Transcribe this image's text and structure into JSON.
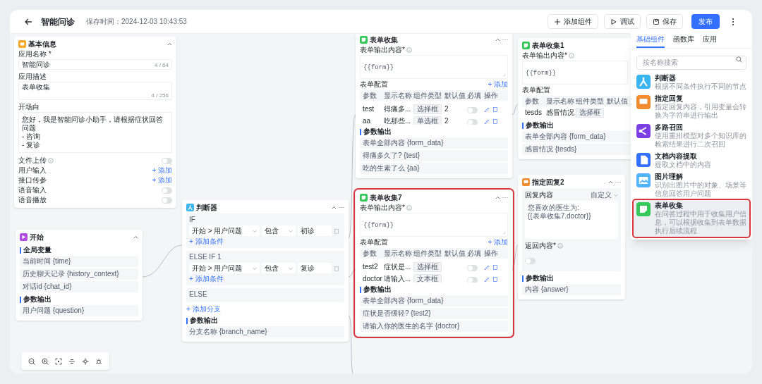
{
  "header": {
    "title": "智能问诊",
    "save_time": "保存时间：2024-12-03 10:43:53",
    "actions": [
      {
        "kind": "add",
        "label": "添加组件"
      },
      {
        "kind": "debug",
        "label": "调试"
      },
      {
        "kind": "save",
        "label": "保存"
      },
      {
        "kind": "publish",
        "label": "发布"
      }
    ]
  },
  "nodes": [
    {
      "kind": "base_info",
      "title": "基本信息",
      "selected": false,
      "fields": [
        {
          "label": "应用名称 *",
          "value": "智能问诊",
          "counter": "4 / 64"
        },
        {
          "label": "应用描述",
          "value": "表单收集",
          "counter": "4 / 256"
        },
        {
          "label": "开场白",
          "lines": [
            "您好，我是智能问诊小助手，请根据症状回答问题",
            "- 咨询",
            "- 复诊"
          ]
        }
      ],
      "settings": [
        {
          "kind": "toggle",
          "label": "文件上传",
          "info": true,
          "on": false
        },
        {
          "kind": "add",
          "label": "用户输入",
          "info": false,
          "action": "+ 添加"
        },
        {
          "kind": "add",
          "label": "接口传参",
          "info": false,
          "action": "+ 添加"
        },
        {
          "kind": "toggle",
          "label": "语音输入",
          "info": false,
          "on": false
        },
        {
          "kind": "toggle",
          "label": "语音播放",
          "info": false,
          "on": false
        }
      ]
    },
    {
      "kind": "form",
      "title": "表单收集",
      "selected": false,
      "output_label": "表单输出内容*",
      "template": "{{form}}",
      "config_label": "表单配置",
      "add": "+ 添加",
      "columns": [
        "参数",
        "显示名称",
        "组件类型",
        "默认值",
        "必填",
        "操作"
      ],
      "rows": [
        {
          "cells": [
            "test",
            "得痛多...",
            "选择框",
            "2"
          ],
          "required": false
        },
        {
          "cells": [
            "aa",
            "吃那些...",
            "单选框",
            "2"
          ],
          "required": false
        }
      ],
      "outputs_label": "参数输出",
      "outputs": [
        "表单全部内容 {form_data}",
        "得痛多久了? {test}",
        "吃的生素了么 {aa}"
      ]
    },
    {
      "kind": "form",
      "title": "表单收集1",
      "selected": false,
      "output_label": "表单输出内容*",
      "template": "{{form}}",
      "config_label": "表单配置",
      "columns": [
        "参数",
        "显示名称",
        "组件类型",
        "默认值"
      ],
      "rows": [
        {
          "cells": [
            "tesds",
            "感冒情况",
            "选择框",
            ""
          ]
        }
      ],
      "outputs_label": "参数输出",
      "outputs": [
        "表单全部内容 {form_data}",
        "感冒情况 {tesds}"
      ]
    },
    {
      "kind": "start",
      "title": "开始",
      "selected": false,
      "groups": [
        {
          "label": "全局变量",
          "items": [
            "当前时间 {time}",
            "历史聊天记录 {history_context}",
            "对话id {chat_id}"
          ]
        },
        {
          "label": "参数输出",
          "items": [
            "用户问题 {question}"
          ]
        }
      ]
    },
    {
      "kind": "condition",
      "title": "判断器",
      "selected": false,
      "branches": [
        {
          "label": "IF",
          "conditions": [
            {
              "field": "开始 > 用户问题",
              "op": "包含",
              "value": "初诊"
            }
          ],
          "add": "+ 添加条件"
        },
        {
          "label": "ELSE IF 1",
          "conditions": [
            {
              "field": "开始 > 用户问题",
              "op": "包含",
              "value": "复诊"
            }
          ],
          "add": "+ 添加条件"
        },
        {
          "label": "ELSE"
        }
      ],
      "add_branch": "+ 添加分支",
      "outputs_label": "参数输出",
      "outputs": [
        "分支名称 {branch_name}"
      ]
    },
    {
      "kind": "form",
      "title": "表单收集7",
      "selected": true,
      "output_label": "表单输出内容*",
      "template": "{{form}}",
      "config_label": "表单配置",
      "add": "+ 添加",
      "columns": [
        "参数",
        "显示名称",
        "组件类型",
        "默认值",
        "必填",
        "操作"
      ],
      "rows": [
        {
          "cells": [
            "test2",
            "症状是...",
            "选择框",
            ""
          ],
          "required": false
        },
        {
          "cells": [
            "doctor",
            "请输入...",
            "文本框",
            ""
          ],
          "required": false
        }
      ],
      "outputs_label": "参数输出",
      "outputs": [
        "表单全部内容 {form_data}",
        "症状是否缓轻? {test2}",
        "请输入你的医生的名字 {doctor}"
      ]
    },
    {
      "kind": "reply",
      "title": "指定回复2",
      "selected": false,
      "content_label": "回复内容",
      "source": "自定义",
      "content_lines": [
        "您喜欢的医生为:",
        "{{表单收集7.doctor}}"
      ],
      "return_label": "返回内容*",
      "return_on": false,
      "outputs_label": "参数输出",
      "outputs": [
        "内容 {answer}"
      ]
    }
  ],
  "panel": {
    "tabs": [
      {
        "label": "基础组件",
        "selected": true
      },
      {
        "label": "函数库",
        "selected": false
      },
      {
        "label": "应用",
        "selected": false
      }
    ],
    "search": {
      "placeholder": "按名称搜索"
    },
    "items": [
      {
        "kind": "condition",
        "title": "判断器",
        "description": "根据不同条件执行不同的节点",
        "selected": false
      },
      {
        "kind": "reply",
        "title": "指定回复",
        "description": "指定回复内容，引用变量会转换为字符串进行输出",
        "selected": false
      },
      {
        "kind": "recall",
        "title": "多路召回",
        "description": "使用重排模型对多个知识库的检索结果进行二次召回",
        "selected": false
      },
      {
        "kind": "document",
        "title": "文档内容提取",
        "description": "提取文档中的内容",
        "selected": false
      },
      {
        "kind": "image",
        "title": "图片理解",
        "description": "识别出图片中的对象、场景等信息回答用户问题",
        "selected": false
      },
      {
        "kind": "form",
        "title": "表单收集",
        "description": "在问答过程中用于收集用户信息，可以根据收集到表单数据执行后续流程",
        "selected": true
      }
    ]
  }
}
